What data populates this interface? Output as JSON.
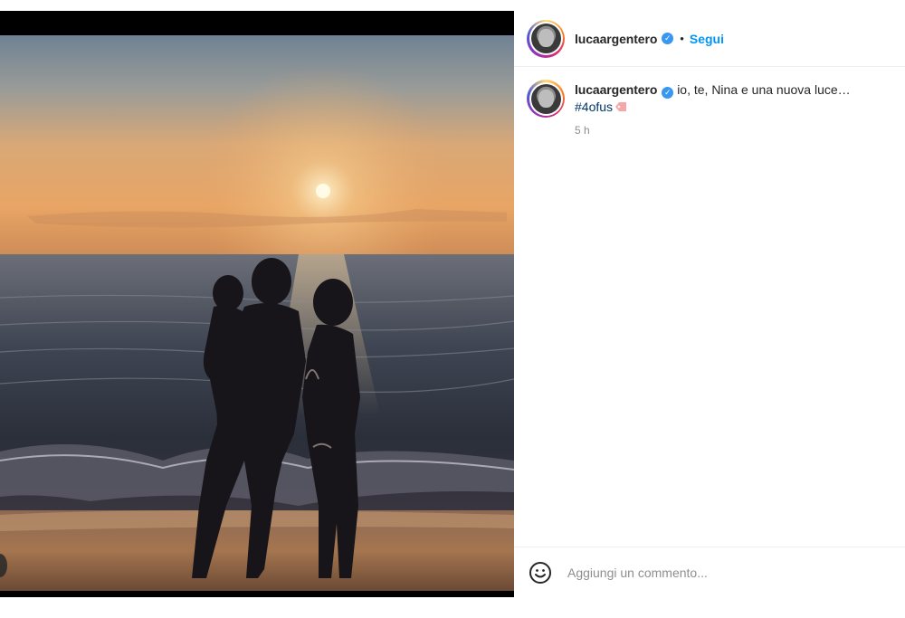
{
  "post": {
    "username": "lucaargentero",
    "separator": "•",
    "follow_label": "Segui"
  },
  "caption": {
    "username": "lucaargentero",
    "text": "io, te, Nina e una nuova luce…",
    "hashtag": "#4ofus",
    "emoji": "label-tag-emoji",
    "time": "5 h"
  },
  "comment": {
    "placeholder": "Aggiungi un commento..."
  },
  "colors": {
    "follow": "#0095f6",
    "verified": "#3897f0",
    "hashtag": "#00376b"
  },
  "icons": [
    "verified-badge-icon",
    "emoji-smiley-icon",
    "carousel-prev-icon"
  ]
}
